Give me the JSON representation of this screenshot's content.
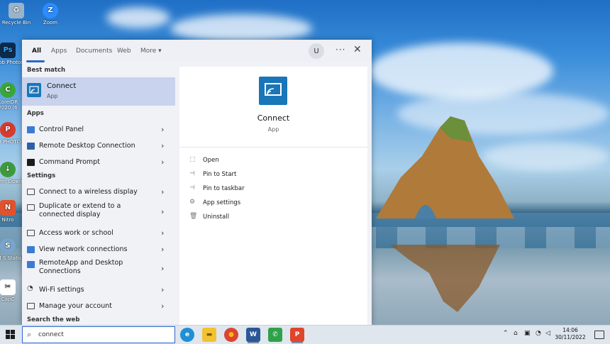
{
  "desktop": {
    "icons": [
      {
        "label": "Recycle Bin",
        "color": "#9bb3c9",
        "glyph": "♻"
      },
      {
        "label": "Zoom",
        "color": "#2d8cff",
        "glyph": "Z"
      },
      {
        "label": "Adob Photos",
        "color": "#0c2a4a",
        "glyph": "Ps"
      },
      {
        "label": "CorelDR 2020 (6",
        "color": "#3aa63a",
        "glyph": "C"
      },
      {
        "label": "Cor PHOTO-",
        "color": "#d63b2f",
        "glyph": "P"
      },
      {
        "label": "Intern Downl",
        "color": "#3e9a3e",
        "glyph": "↓"
      },
      {
        "label": "Nitro",
        "color": "#e2522c",
        "glyph": "N"
      },
      {
        "label": "IBM S Statist",
        "color": "#7aa4cc",
        "glyph": "S"
      },
      {
        "label": "CapC",
        "color": "#1a1a1a",
        "glyph": "✂"
      }
    ]
  },
  "search": {
    "tabs": [
      "All",
      "Apps",
      "Documents",
      "Web",
      "More ▾"
    ],
    "user_initial": "U",
    "more_dots": "···",
    "close": "✕",
    "best_match_heading": "Best match",
    "best": {
      "title": "Connect",
      "subtitle": "App"
    },
    "apps_heading": "Apps",
    "apps": [
      {
        "label": "Control Panel",
        "color": "#3a7bd5"
      },
      {
        "label": "Remote Desktop Connection",
        "color": "#2f5fa8"
      },
      {
        "label": "Command Prompt",
        "color": "#1b1b1b"
      }
    ],
    "settings_heading": "Settings",
    "settings": [
      {
        "label": "Connect to a wireless display"
      },
      {
        "label": "Duplicate or extend to a connected display"
      },
      {
        "label": "Access work or school"
      },
      {
        "label": "View network connections"
      },
      {
        "label": "RemoteApp and Desktop Connections"
      },
      {
        "label": "Wi-Fi settings"
      },
      {
        "label": "Manage your account"
      }
    ],
    "web_heading": "Search the web",
    "query": "connect",
    "preview": {
      "name": "Connect",
      "type": "App",
      "actions": [
        {
          "label": "Open",
          "icon": "open-icon"
        },
        {
          "label": "Pin to Start",
          "icon": "pin-icon"
        },
        {
          "label": "Pin to taskbar",
          "icon": "pin-icon"
        },
        {
          "label": "App settings",
          "icon": "gear-icon"
        },
        {
          "label": "Uninstall",
          "icon": "trash-icon"
        }
      ]
    }
  },
  "taskbar": {
    "apps": [
      {
        "name": "Edge",
        "color": "#1f8fd6",
        "glyph": "e"
      },
      {
        "name": "File Explorer",
        "color": "#f2c230",
        "glyph": "▬"
      },
      {
        "name": "Chrome",
        "color": "#db4437",
        "glyph": "●"
      },
      {
        "name": "Word",
        "color": "#2b5797",
        "glyph": "W"
      },
      {
        "name": "Phone",
        "color": "#2fa14a",
        "glyph": "✆"
      },
      {
        "name": "Photo",
        "color": "#e0442b",
        "glyph": "P"
      }
    ],
    "tray_chevron": "⌃",
    "time": "14:06",
    "date": "30/11/2022"
  }
}
